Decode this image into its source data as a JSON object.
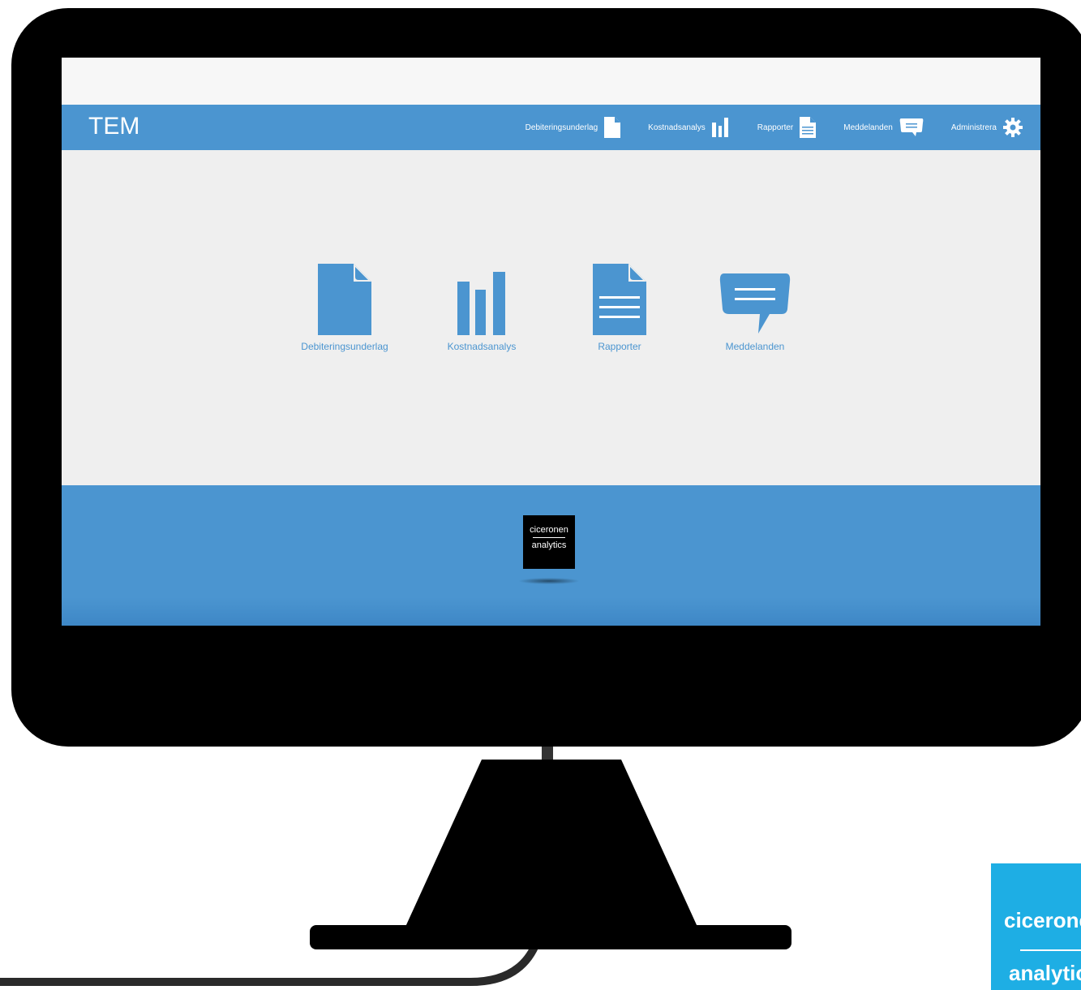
{
  "app": {
    "title": "TEM"
  },
  "nav": [
    {
      "label": "Debiteringsunderlag",
      "icon": "document-icon"
    },
    {
      "label": "Kostnadsanalys",
      "icon": "bar-chart-icon"
    },
    {
      "label": "Rapporter",
      "icon": "report-icon"
    },
    {
      "label": "Meddelanden",
      "icon": "message-icon"
    },
    {
      "label": "Administrera",
      "icon": "gear-icon"
    }
  ],
  "tiles": [
    {
      "label": "Debiteringsunderlag",
      "icon": "document-icon"
    },
    {
      "label": "Kostnadsanalys",
      "icon": "bar-chart-icon"
    },
    {
      "label": "Rapporter",
      "icon": "report-icon"
    },
    {
      "label": "Meddelanden",
      "icon": "message-icon"
    }
  ],
  "footer": {
    "logo_line1": "ciceronen",
    "logo_line2": "analytics"
  },
  "corner_logo": {
    "line1": "ciceronen",
    "line2": "analytics"
  },
  "colors": {
    "accent": "#4b95d0",
    "background": "#efefef",
    "bezel": "#000000",
    "corner_logo": "#1eaee4"
  }
}
